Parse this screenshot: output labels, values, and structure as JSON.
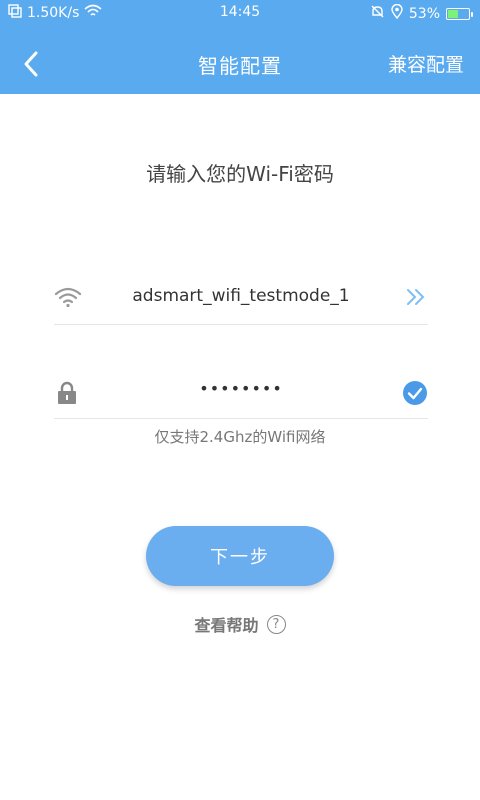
{
  "status_bar": {
    "speed": "1.50K/s",
    "time": "14:45",
    "battery_text": "53%",
    "battery_level": 0.53
  },
  "nav": {
    "title": "智能配置",
    "compat_label": "兼容配置"
  },
  "main": {
    "prompt": "请输入您的Wi-Fi密码",
    "ssid_value": "adsmart_wifi_testmode_1",
    "password_masked": "••••••••",
    "hint": "仅支持2.4Ghz的Wifi网络",
    "next_label": "下一步",
    "help_label": "查看帮助",
    "help_icon_glyph": "?"
  },
  "colors": {
    "header": "#5aaaf0",
    "button": "#6aaef0",
    "accent": "#4a9ae8"
  },
  "icons": {
    "back": "chevron-left-icon",
    "wifi": "wifi-icon",
    "lock": "lock-icon",
    "more": "double-chevron-right-icon",
    "check": "check-circle-icon",
    "help": "question-circle-icon"
  }
}
